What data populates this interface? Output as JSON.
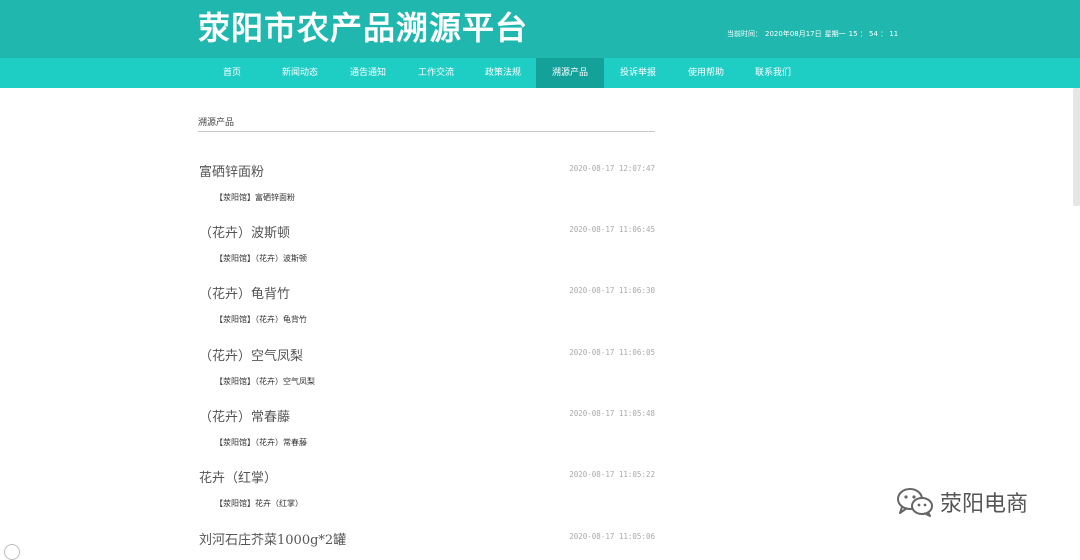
{
  "header": {
    "title": "荥阳市农产品溯源平台",
    "datetime_label": "当前时间：",
    "datetime_date": "2020年08月17日",
    "datetime_weekday": "星期一",
    "datetime_time": "15 ： 54 ： 11"
  },
  "nav": {
    "items": [
      {
        "label": "首页"
      },
      {
        "label": "新闻动态"
      },
      {
        "label": "通告通知"
      },
      {
        "label": "工作交流"
      },
      {
        "label": "政策法规"
      },
      {
        "label": "溯源产品"
      },
      {
        "label": "投诉举报"
      },
      {
        "label": "使用帮助"
      },
      {
        "label": "联系我们"
      }
    ],
    "active": "溯源产品"
  },
  "main": {
    "section_title": "溯源产品",
    "items": [
      {
        "title": "富硒锌面粉",
        "date": "2020-08-17 12:07:47",
        "desc": "【荥阳馆】富硒锌面粉"
      },
      {
        "title": "（花卉）波斯顿",
        "date": "2020-08-17 11:06:45",
        "desc": "【荥阳馆】（花卉）波斯顿"
      },
      {
        "title": "（花卉）龟背竹",
        "date": "2020-08-17 11:06:30",
        "desc": "【荥阳馆】（花卉）龟背竹"
      },
      {
        "title": "（花卉）空气凤梨",
        "date": "2020-08-17 11:06:05",
        "desc": "【荥阳馆】（花卉）空气凤梨"
      },
      {
        "title": "（花卉）常春藤",
        "date": "2020-08-17 11:05:48",
        "desc": "【荥阳馆】（花卉）常春藤"
      },
      {
        "title": "花卉（红掌）",
        "date": "2020-08-17 11:05:22",
        "desc": "【荥阳馆】花卉（红掌）"
      },
      {
        "title": "刘河石庄芥菜1000g*2罐",
        "date": "2020-08-17 11:05:06",
        "desc": ""
      }
    ]
  },
  "watermark": {
    "text": "荥阳电商",
    "icon": "wechat-icon"
  }
}
